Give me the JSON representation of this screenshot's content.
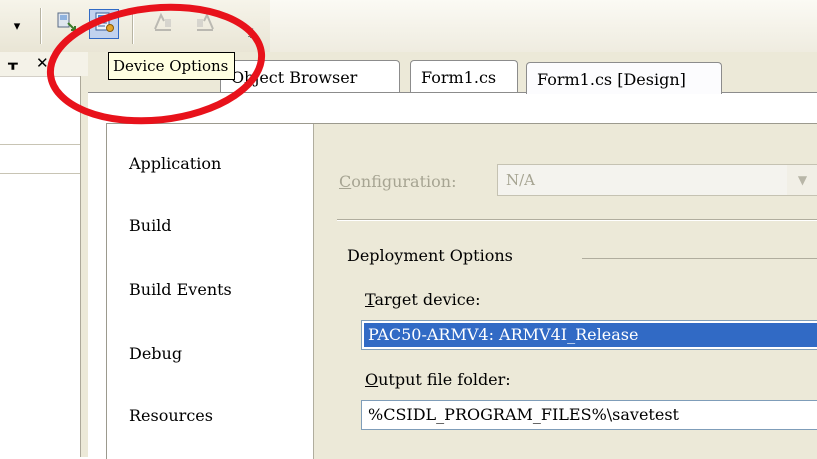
{
  "toolbar": {
    "buttons": [
      {
        "name": "connect-device-icon",
        "state": "normal"
      },
      {
        "name": "device-options-icon",
        "state": "active"
      },
      {
        "name": "align-left-icon",
        "state": "disabled"
      },
      {
        "name": "align-right-icon",
        "state": "disabled"
      }
    ]
  },
  "tooltip": {
    "text": "Device Options"
  },
  "tabs": [
    {
      "label": "Object Browser"
    },
    {
      "label": "Form1.cs"
    },
    {
      "label": "Form1.cs [Design]"
    }
  ],
  "nav": {
    "items": [
      "Application",
      "Build",
      "Build Events",
      "Debug",
      "Resources"
    ]
  },
  "page": {
    "configuration_label_prefix": "C",
    "configuration_label_rest": "onfiguration:",
    "configuration_value": "N/A",
    "group_title": "Deployment Options",
    "target_label_prefix": "T",
    "target_label_rest": "arget device:",
    "target_value": "PAC50-ARMV4: ARMV4I_Release",
    "output_label_prefix": "O",
    "output_label_rest": "utput file folder:",
    "output_value": "%CSIDL_PROGRAM_FILES%\\savetest"
  },
  "colors": {
    "highlight_ring": "#e8121b",
    "selection": "#316ac5",
    "tooltip_bg": "#ffffe1"
  }
}
